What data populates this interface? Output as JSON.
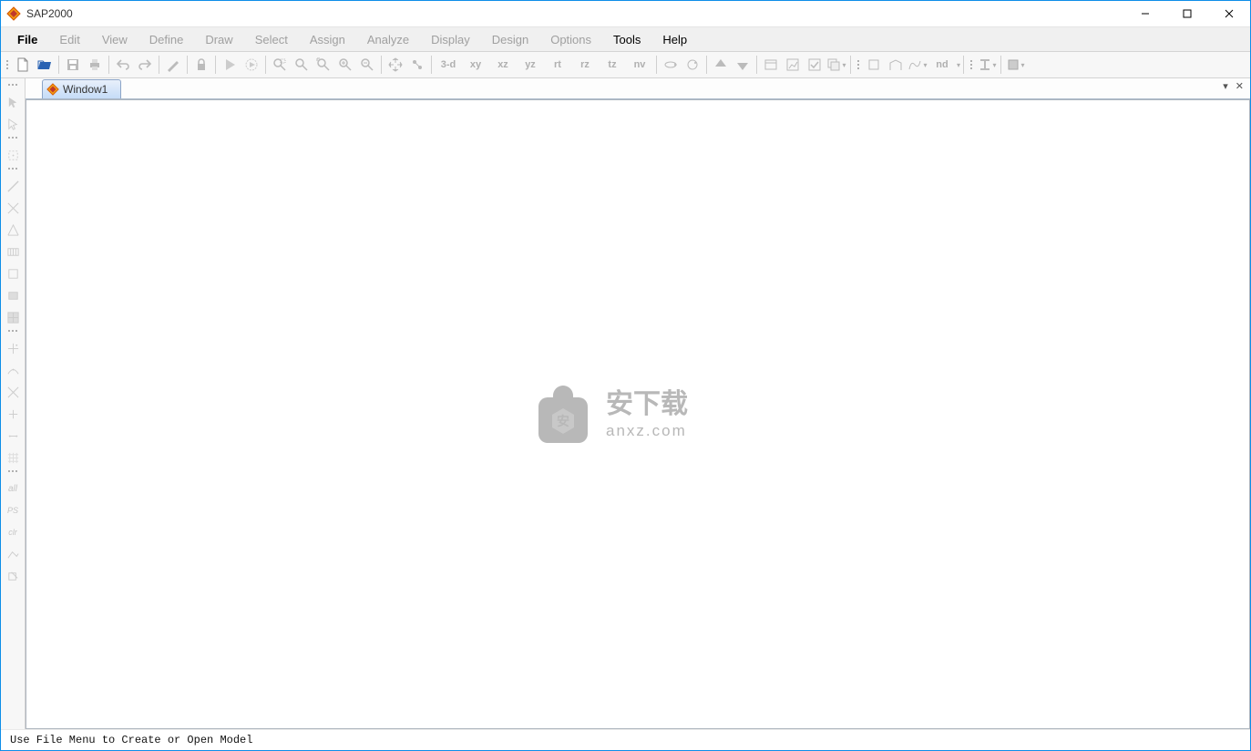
{
  "titlebar": {
    "title": "SAP2000"
  },
  "menubar": {
    "items": [
      {
        "label": "File",
        "enabled": true,
        "cls": "file"
      },
      {
        "label": "Edit",
        "enabled": false
      },
      {
        "label": "View",
        "enabled": false
      },
      {
        "label": "Define",
        "enabled": false
      },
      {
        "label": "Draw",
        "enabled": false
      },
      {
        "label": "Select",
        "enabled": false
      },
      {
        "label": "Assign",
        "enabled": false
      },
      {
        "label": "Analyze",
        "enabled": false
      },
      {
        "label": "Display",
        "enabled": false
      },
      {
        "label": "Design",
        "enabled": false
      },
      {
        "label": "Options",
        "enabled": false
      },
      {
        "label": "Tools",
        "enabled": true
      },
      {
        "label": "Help",
        "enabled": true
      }
    ]
  },
  "toolbar": {
    "groups": {
      "file": [
        "new",
        "open",
        "save",
        "print"
      ],
      "edit": [
        "undo",
        "redo",
        "pencil",
        "lock"
      ],
      "run": [
        "run",
        "run-anim"
      ],
      "zoom": [
        "zoom-rubber",
        "zoom-in",
        "zoom-out",
        "zoom-full",
        "zoom-prev"
      ],
      "view": [
        "pan",
        "show-selection"
      ],
      "planes": [
        "3-d",
        "xy",
        "xz",
        "yz",
        "rt",
        "rz",
        "tz",
        "nv"
      ],
      "move": [
        "rotate",
        "perspective"
      ],
      "pan2": [
        "up",
        "down"
      ],
      "assign": [
        "named-view",
        "mode-display",
        "object-model",
        "named-set"
      ],
      "frame": [
        "frame1",
        "frame2",
        "frame3",
        "nd"
      ],
      "section": [
        "isection",
        "box"
      ]
    }
  },
  "side": {
    "tools1": [
      "pointer",
      "pointer-alt",
      "rect-select",
      "line",
      "poly1",
      "poly2",
      "wall",
      "area",
      "area2",
      "sheet"
    ],
    "tools2": [
      "snap-pt",
      "snap-line",
      "intersect",
      "perp",
      "edge-snap",
      "grid-snap"
    ],
    "tools3": [
      "all",
      "PS",
      "clr",
      "assign1",
      "assign2"
    ]
  },
  "tabs": {
    "items": [
      {
        "label": "Window1"
      }
    ]
  },
  "watermark": {
    "line1": "安下载",
    "line2": "anxz.com"
  },
  "statusbar": {
    "text": "Use File Menu to Create or Open Model"
  }
}
